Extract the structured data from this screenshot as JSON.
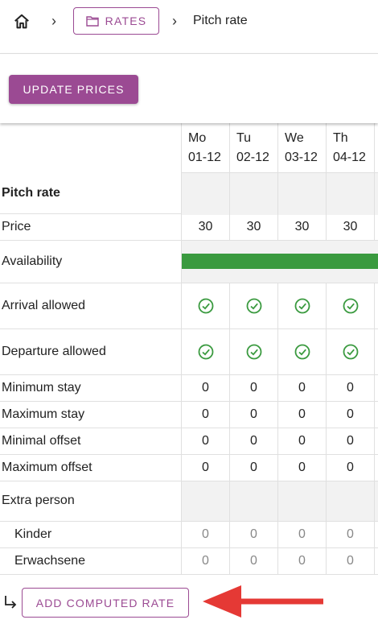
{
  "breadcrumb": {
    "home_icon": "home-icon",
    "rates_label": "RATES",
    "current": "Pitch rate"
  },
  "toolbar": {
    "update_label": "UPDATE PRICES"
  },
  "days": [
    {
      "dow": "Mo",
      "date": "01-12"
    },
    {
      "dow": "Tu",
      "date": "02-12"
    },
    {
      "dow": "We",
      "date": "03-12"
    },
    {
      "dow": "Th",
      "date": "04-12"
    }
  ],
  "section_title": "Pitch rate",
  "rows": {
    "price": {
      "label": "Price",
      "values": [
        "30",
        "30",
        "30",
        "30"
      ]
    },
    "availability": {
      "label": "Availability",
      "color": "#3a9a3f"
    },
    "arrival": {
      "label": "Arrival allowed"
    },
    "departure": {
      "label": "Departure allowed"
    },
    "min_stay": {
      "label": "Minimum stay",
      "values": [
        "0",
        "0",
        "0",
        "0"
      ]
    },
    "max_stay": {
      "label": "Maximum stay",
      "values": [
        "0",
        "0",
        "0",
        "0"
      ]
    },
    "min_offset": {
      "label": "Minimal offset",
      "values": [
        "0",
        "0",
        "0",
        "0"
      ]
    },
    "max_offset": {
      "label": "Maximum offset",
      "values": [
        "0",
        "0",
        "0",
        "0"
      ]
    },
    "extra_person": {
      "label": "Extra person"
    },
    "kinder": {
      "label": "Kinder",
      "values": [
        "0",
        "0",
        "0",
        "0"
      ]
    },
    "erwachsene": {
      "label": "Erwachsene",
      "values": [
        "0",
        "0",
        "0",
        "0"
      ]
    }
  },
  "add_label": "ADD COMPUTED RATE",
  "colors": {
    "accent": "#9b4a93",
    "success": "#3a9a3f",
    "arrow": "#e53935"
  }
}
